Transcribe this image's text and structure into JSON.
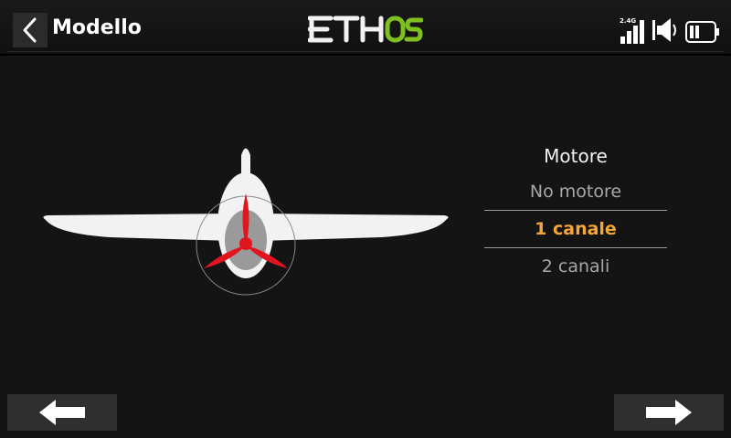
{
  "header": {
    "title": "Modello",
    "logo_text": "ETHOS",
    "logo_colors": {
      "eth": "#f2f2f2",
      "os": "#7fc021"
    },
    "signal_label": "2.4G",
    "icons": [
      "back-icon",
      "signal-icon",
      "volume-icon",
      "battery-icon"
    ]
  },
  "options": {
    "title": "Motore",
    "items": [
      {
        "label": "No motore",
        "selected": false
      },
      {
        "label": "1 canale",
        "selected": true
      },
      {
        "label": "2 canali",
        "selected": false
      }
    ],
    "accent_color": "#f7a635"
  },
  "footer": {
    "prev_icon": "arrow-left-icon",
    "next_icon": "arrow-right-icon"
  }
}
